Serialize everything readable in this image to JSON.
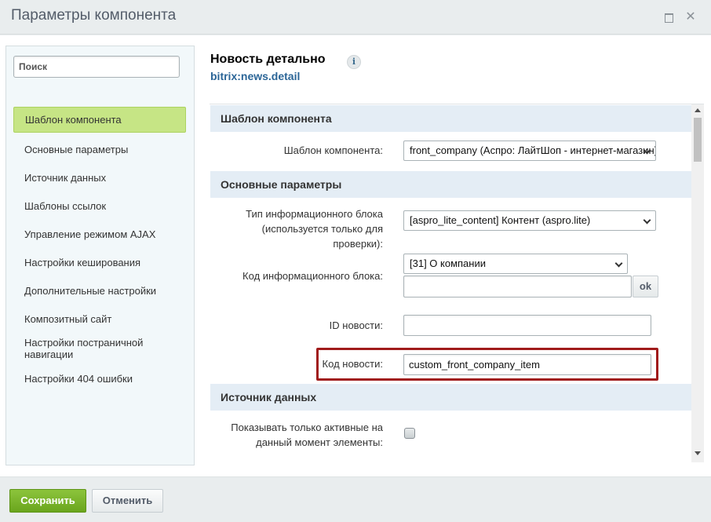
{
  "window": {
    "title": "Параметры компонента",
    "maximize_icon": "maximize-icon",
    "close_icon": "close-icon",
    "close_glyph": "✕"
  },
  "sidebar": {
    "search_placeholder": "Поиск",
    "items": [
      {
        "label": "Шаблон компонента",
        "active": true
      },
      {
        "label": "Основные параметры"
      },
      {
        "label": "Источник данных"
      },
      {
        "label": "Шаблоны ссылок"
      },
      {
        "label": "Управление режимом AJAX"
      },
      {
        "label": "Настройки кеширования"
      },
      {
        "label": "Дополнительные настройки"
      },
      {
        "label": "Композитный сайт"
      },
      {
        "label": "Настройки постраничной навигации"
      },
      {
        "label": "Настройки 404 ошибки"
      }
    ]
  },
  "component": {
    "title": "Новость детально",
    "code": "bitrix:news.detail",
    "info_icon": "info-icon",
    "info_glyph": "i"
  },
  "form": {
    "sections": [
      {
        "title": "Шаблон компонента"
      },
      {
        "title": "Основные параметры"
      },
      {
        "title": "Источник данных"
      }
    ],
    "template": {
      "label": "Шаблон компонента:",
      "value": "front_company (Аспро: ЛайтШоп - интернет-магазин)"
    },
    "iblock_type": {
      "label_line1": "Тип информационного блока",
      "label_line2": "(используется только для проверки):",
      "value": "[aspro_lite_content] Контент (aspro.lite)"
    },
    "iblock_code": {
      "label": "Код информационного блока:",
      "value": "[31] О компании",
      "extra_input": "",
      "ok_label": "ok"
    },
    "news_id": {
      "label": "ID новости:",
      "value": ""
    },
    "news_code": {
      "label": "Код новости:",
      "value": "custom_front_company_item"
    },
    "active_only": {
      "label_line1": "Показывать только активные на",
      "label_line2": "данный момент элементы:",
      "checked": false
    }
  },
  "footer": {
    "save_label": "Сохранить",
    "cancel_label": "Отменить"
  },
  "colors": {
    "accent_green": "#6aa51d",
    "active_item": "#c6e585",
    "section_bg": "#e4edf5",
    "highlight": "#a01b1b",
    "link_blue": "#2b6597"
  }
}
